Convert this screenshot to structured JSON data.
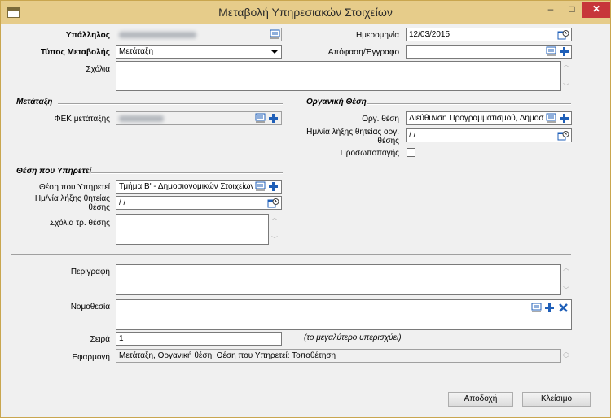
{
  "window": {
    "title": "Μεταβολή Υπηρεσιακών Στοιχείων",
    "minimize": "–",
    "maximize": "□",
    "close": "✕"
  },
  "top": {
    "employee_label": "Υπάλληλος",
    "employee_value": "",
    "type_label": "Τύπος Μεταβολής",
    "type_value": "Μετάταξη",
    "date_label": "Ημερομηνία",
    "date_value": "12/03/2015",
    "decision_label": "Απόφαση/Έγγραφο",
    "decision_value": "",
    "comments_label": "Σχόλια"
  },
  "metataxi": {
    "section_title": "Μετάταξη",
    "fek_label": "ΦΕΚ μετάταξης",
    "fek_value": ""
  },
  "organiki": {
    "section_title": "Οργανική Θέση",
    "org_label": "Οργ. θέση",
    "org_value": "Διεύθυνση Προγραμματισμού, Δημοσι",
    "expiry_label": "Ημ/νία λήξης θητείας οργ. θέσης",
    "expiry_value": " / /",
    "personal_label": "Προσωποπαγής"
  },
  "thesi": {
    "section_title": "Θέση που Υπηρετεί",
    "pos_label": "Θέση που Υπηρετεί",
    "pos_value": "Τμήμα Β' - Δημοσιονομικών Στοιχείων",
    "expiry_label": "Ημ/νία λήξης θητείας θέσης",
    "expiry_value": " / /",
    "comments_label": "Σχόλια τρ. θέσης"
  },
  "bottom": {
    "description_label": "Περιγραφή",
    "legislation_label": "Νομοθεσία",
    "order_label": "Σειρά",
    "order_value": "1",
    "order_note": "(το μεγαλύτερο υπερισχύει)",
    "application_label": "Εφαρμογή",
    "application_value": "Μετάταξη, Οργανική θέση, Θέση που Υπηρετεί: Τοποθέτηση"
  },
  "buttons": {
    "accept": "Αποδοχή",
    "close": "Κλείσιμο"
  },
  "colors": {
    "titlebar": "#e6cc8a",
    "close_button": "#c7363a",
    "accent_icon": "#1f5fb8"
  }
}
